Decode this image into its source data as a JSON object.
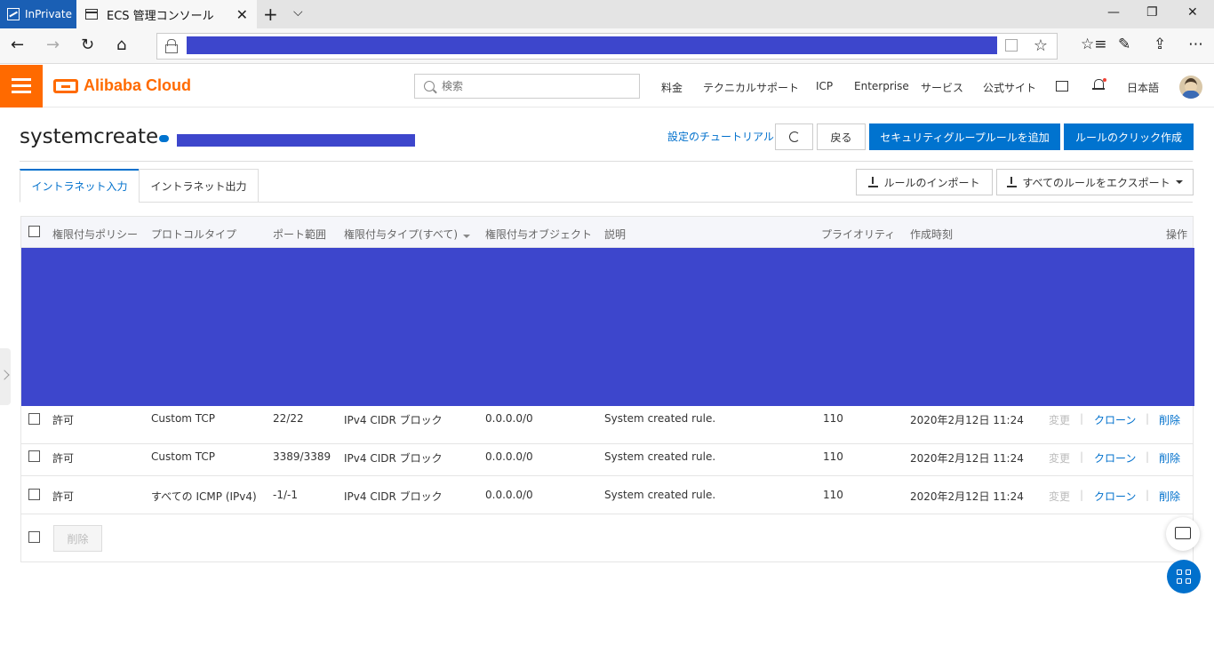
{
  "browser": {
    "inprivate_label": "InPrivate",
    "tab_title": "ECS 管理コンソール",
    "tab_close": "✕",
    "new_tab": "+",
    "tab_dropdown": "⌵",
    "minimize": "—",
    "restore": "❐",
    "close": "✕",
    "back": "←",
    "forward": "→",
    "reload": "↻",
    "home": "⌂",
    "favorite_star": "☆",
    "favorites": "☆≡",
    "pen": "✎",
    "share": "⇪",
    "more": "⋯"
  },
  "topbar": {
    "brand": "Alibaba Cloud",
    "search_placeholder": "検索",
    "links": [
      "料金",
      "テクニカルサポート",
      "ICP",
      "Enterprise",
      "サービス",
      "公式サイト"
    ],
    "language": "日本語"
  },
  "page": {
    "title": "systemcreate",
    "tutorial_link": "設定のチュートリアル",
    "back_button": "戻る",
    "add_rule_button": "セキュリティグループルールを追加",
    "quick_create_button": "ルールのクリック作成",
    "tabs": [
      "イントラネット入力",
      "イントラネット出力"
    ],
    "import_button": "ルールのインポート",
    "export_button": "すべてのルールをエクスポート"
  },
  "table": {
    "headers": {
      "policy": "権限付与ポリシー",
      "protocol": "プロトコルタイプ",
      "port": "ポート範囲",
      "auth_type": "権限付与タイプ(すべて)",
      "auth_object": "権限付与オブジェクト",
      "description": "説明",
      "priority": "プライオリティ",
      "created": "作成時刻",
      "actions": "操作"
    },
    "rows": [
      {
        "policy": "許可",
        "protocol": "Custom TCP",
        "port": "22/22",
        "auth_type": "IPv4 CIDR ブロック",
        "auth_object": "0.0.0.0/0",
        "description": "System created rule.",
        "priority": "110",
        "created": "2020年2月12日 11:24",
        "edit": "変更",
        "clone": "クローン",
        "delete": "削除"
      },
      {
        "policy": "許可",
        "protocol": "Custom TCP",
        "port": "3389/3389",
        "auth_type": "IPv4 CIDR ブロック",
        "auth_object": "0.0.0.0/0",
        "description": "System created rule.",
        "priority": "110",
        "created": "2020年2月12日 11:24",
        "edit": "変更",
        "clone": "クローン",
        "delete": "削除"
      },
      {
        "policy": "許可",
        "protocol": "すべての ICMP (IPv4)",
        "port": "-1/-1",
        "auth_type": "IPv4 CIDR ブロック",
        "auth_object": "0.0.0.0/0",
        "description": "System created rule.",
        "priority": "110",
        "created": "2020年2月12日 11:24",
        "edit": "変更",
        "clone": "クローン",
        "delete": "削除"
      }
    ],
    "separator": "|",
    "bulk_delete": "削除"
  },
  "colors": {
    "accent_orange": "#ff6a00",
    "link_blue": "#0070cc",
    "primary_button": "#0073cf",
    "redaction": "#3d46cc"
  },
  "icons": [
    "menu-icon",
    "alibaba-logo-icon",
    "search-icon",
    "terminal-icon",
    "bell-icon",
    "refresh-icon",
    "download-icon",
    "upload-icon",
    "chat-icon",
    "apps-icon"
  ]
}
